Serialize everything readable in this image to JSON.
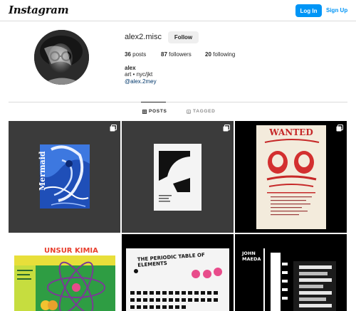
{
  "nav": {
    "logo_text": "Instagram",
    "login_label": "Log In",
    "signup_label": "Sign Up",
    "accent_color": "#0095f6"
  },
  "profile": {
    "username": "alex2.misc",
    "follow_label": "Follow",
    "posts_count": "36",
    "posts_label": "posts",
    "followers_count": "87",
    "followers_label": "followers",
    "following_count": "20",
    "following_label": "following",
    "name": "alex",
    "bio": "art • nyc/jkt",
    "handle_link": "@alex.2mey"
  },
  "tabs": [
    {
      "label": "POSTS",
      "icon": "grid-icon",
      "active": true
    },
    {
      "label": "TAGGED",
      "icon": "tag-icon",
      "active": false
    }
  ],
  "posts": [
    {
      "id": "post-1",
      "art_text": "Mermaid",
      "multi": true
    },
    {
      "id": "post-2",
      "art_text": "",
      "multi": true
    },
    {
      "id": "post-3",
      "art_text": "WANTED",
      "multi": true
    },
    {
      "id": "post-4",
      "art_text": "UNSUR KIMIA",
      "multi": false
    },
    {
      "id": "post-5",
      "art_text": "THE PERIODIC TABLE OF ELEMENTS",
      "multi": false
    },
    {
      "id": "post-6",
      "art_text": "JOHN MAEDA",
      "multi": false
    }
  ]
}
